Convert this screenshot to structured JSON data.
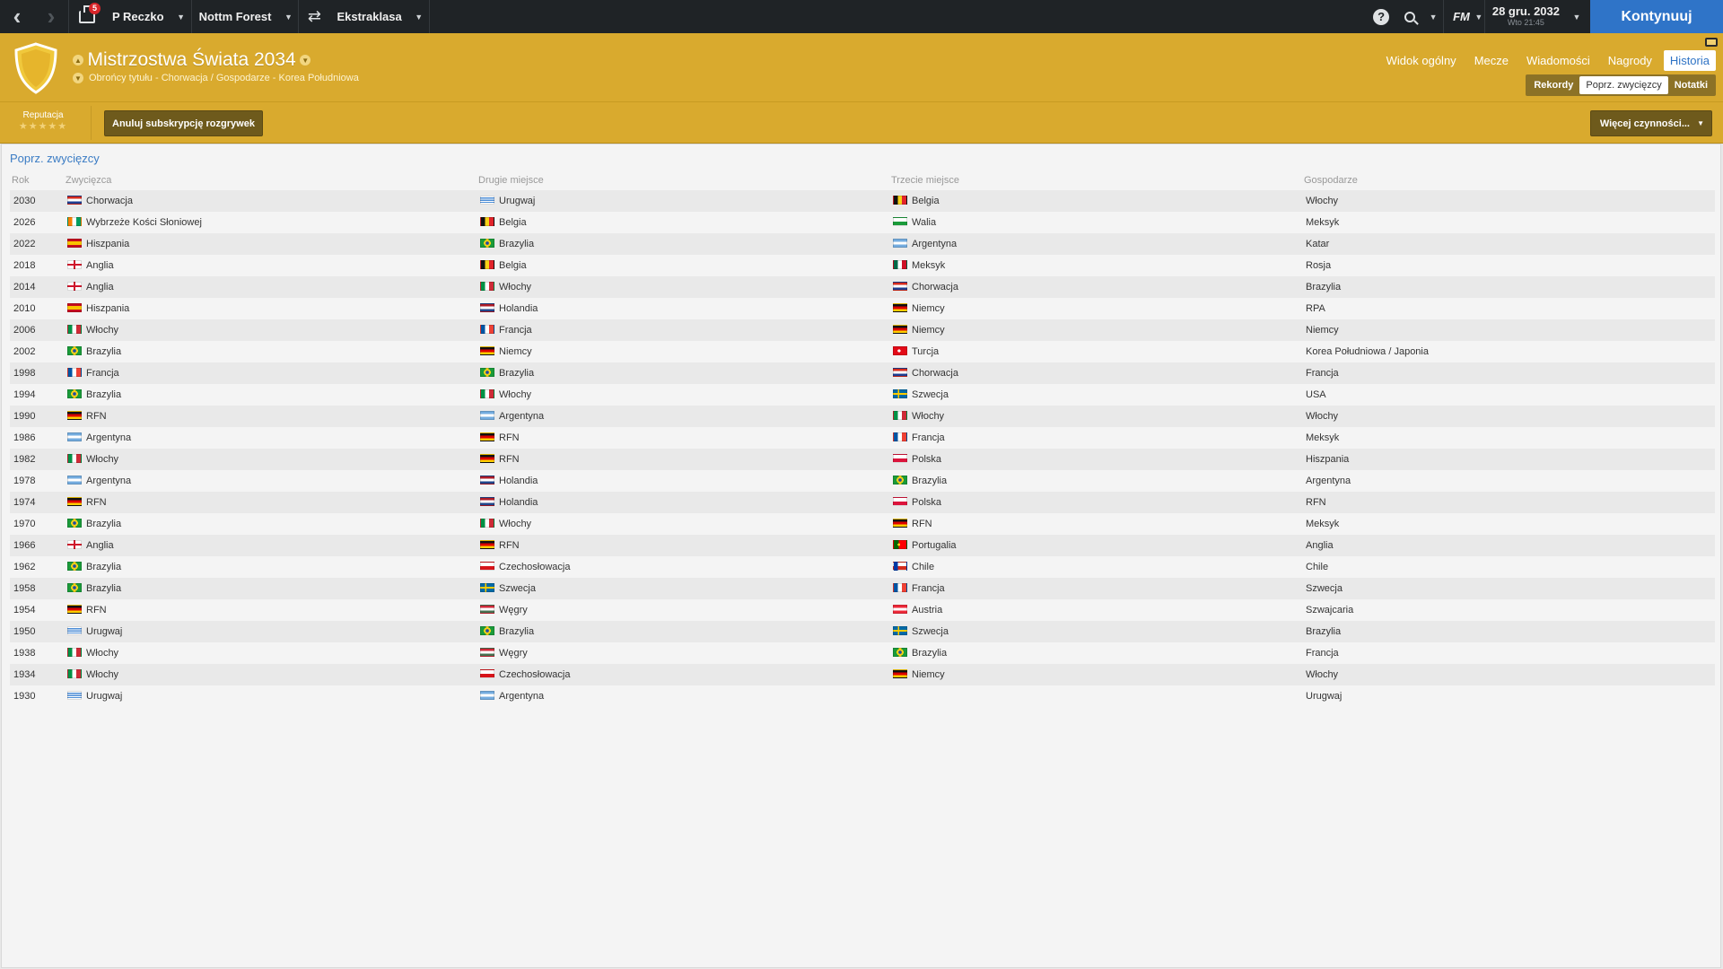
{
  "topbar": {
    "inbox_count": "5",
    "manager": "P Reczko",
    "club": "Nottm Forest",
    "league": "Ekstraklasa",
    "fm_logo": "FM",
    "date": "28 gru. 2032",
    "date_sub": "Wto 21:45",
    "continue_label": "Kontynuuj"
  },
  "header": {
    "title": "Mistrzostwa Świata 2034",
    "subtitle": "Obrońcy tytułu - Chorwacja / Gospodarze - Korea Południowa",
    "tabs": [
      "Widok ogólny",
      "Mecze",
      "Wiadomości",
      "Nagrody",
      "Historia"
    ],
    "active_tab": "Historia",
    "subtabs": [
      "Rekordy",
      "Poprz. zwycięzcy",
      "Notatki"
    ],
    "active_subtab": "Poprz. zwycięzcy",
    "accent_color": "#d9aa2e"
  },
  "actions": {
    "reputation_label": "Reputacja",
    "reputation_stars": "★★★★★",
    "unsubscribe_label": "Anuluj subskrypcję rozgrywek",
    "more_actions_label": "Więcej czynności..."
  },
  "content": {
    "section_title": "Poprz. zwycięzcy",
    "columns": {
      "year": "Rok",
      "winner": "Zwycięzca",
      "second": "Drugie miejsce",
      "third": "Trzecie miejsce",
      "host": "Gospodarze"
    },
    "rows": [
      {
        "year": "2030",
        "winner": "Chorwacja",
        "wf": "hr",
        "second": "Urugwaj",
        "sf": "uy",
        "third": "Belgia",
        "tf": "be",
        "host": "Włochy"
      },
      {
        "year": "2026",
        "winner": "Wybrzeże Kości Słoniowej",
        "wf": "ci",
        "second": "Belgia",
        "sf": "be",
        "third": "Walia",
        "tf": "wa",
        "host": "Meksyk"
      },
      {
        "year": "2022",
        "winner": "Hiszpania",
        "wf": "es",
        "second": "Brazylia",
        "sf": "br",
        "third": "Argentyna",
        "tf": "ar",
        "host": "Katar"
      },
      {
        "year": "2018",
        "winner": "Anglia",
        "wf": "en",
        "second": "Belgia",
        "sf": "be",
        "third": "Meksyk",
        "tf": "mx",
        "host": "Rosja"
      },
      {
        "year": "2014",
        "winner": "Anglia",
        "wf": "en",
        "second": "Włochy",
        "sf": "it",
        "third": "Chorwacja",
        "tf": "hr",
        "host": "Brazylia"
      },
      {
        "year": "2010",
        "winner": "Hiszpania",
        "wf": "es",
        "second": "Holandia",
        "sf": "nl",
        "third": "Niemcy",
        "tf": "de",
        "host": "RPA"
      },
      {
        "year": "2006",
        "winner": "Włochy",
        "wf": "it",
        "second": "Francja",
        "sf": "fr",
        "third": "Niemcy",
        "tf": "de",
        "host": "Niemcy"
      },
      {
        "year": "2002",
        "winner": "Brazylia",
        "wf": "br",
        "second": "Niemcy",
        "sf": "de",
        "third": "Turcja",
        "tf": "tr",
        "host": "Korea Południowa / Japonia"
      },
      {
        "year": "1998",
        "winner": "Francja",
        "wf": "fr",
        "second": "Brazylia",
        "sf": "br",
        "third": "Chorwacja",
        "tf": "hr",
        "host": "Francja"
      },
      {
        "year": "1994",
        "winner": "Brazylia",
        "wf": "br",
        "second": "Włochy",
        "sf": "it",
        "third": "Szwecja",
        "tf": "se",
        "host": "USA"
      },
      {
        "year": "1990",
        "winner": "RFN",
        "wf": "de",
        "second": "Argentyna",
        "sf": "ar",
        "third": "Włochy",
        "tf": "it",
        "host": "Włochy"
      },
      {
        "year": "1986",
        "winner": "Argentyna",
        "wf": "ar",
        "second": "RFN",
        "sf": "de",
        "third": "Francja",
        "tf": "fr",
        "host": "Meksyk"
      },
      {
        "year": "1982",
        "winner": "Włochy",
        "wf": "it",
        "second": "RFN",
        "sf": "de",
        "third": "Polska",
        "tf": "pl",
        "host": "Hiszpania"
      },
      {
        "year": "1978",
        "winner": "Argentyna",
        "wf": "ar",
        "second": "Holandia",
        "sf": "nl",
        "third": "Brazylia",
        "tf": "br",
        "host": "Argentyna"
      },
      {
        "year": "1974",
        "winner": "RFN",
        "wf": "de",
        "second": "Holandia",
        "sf": "nl",
        "third": "Polska",
        "tf": "pl",
        "host": "RFN"
      },
      {
        "year": "1970",
        "winner": "Brazylia",
        "wf": "br",
        "second": "Włochy",
        "sf": "it",
        "third": "RFN",
        "tf": "de",
        "host": "Meksyk"
      },
      {
        "year": "1966",
        "winner": "Anglia",
        "wf": "en",
        "second": "RFN",
        "sf": "de",
        "third": "Portugalia",
        "tf": "pt",
        "host": "Anglia"
      },
      {
        "year": "1962",
        "winner": "Brazylia",
        "wf": "br",
        "second": "Czechosłowacja",
        "sf": "cz",
        "third": "Chile",
        "tf": "cl",
        "host": "Chile"
      },
      {
        "year": "1958",
        "winner": "Brazylia",
        "wf": "br",
        "second": "Szwecja",
        "sf": "se",
        "third": "Francja",
        "tf": "fr",
        "host": "Szwecja"
      },
      {
        "year": "1954",
        "winner": "RFN",
        "wf": "de",
        "second": "Węgry",
        "sf": "hu",
        "third": "Austria",
        "tf": "at",
        "host": "Szwajcaria"
      },
      {
        "year": "1950",
        "winner": "Urugwaj",
        "wf": "uy",
        "second": "Brazylia",
        "sf": "br",
        "third": "Szwecja",
        "tf": "se",
        "host": "Brazylia"
      },
      {
        "year": "1938",
        "winner": "Włochy",
        "wf": "it",
        "second": "Węgry",
        "sf": "hu",
        "third": "Brazylia",
        "tf": "br",
        "host": "Francja"
      },
      {
        "year": "1934",
        "winner": "Włochy",
        "wf": "it",
        "second": "Czechosłowacja",
        "sf": "cz",
        "third": "Niemcy",
        "tf": "de",
        "host": "Włochy"
      },
      {
        "year": "1930",
        "winner": "Urugwaj",
        "wf": "uy",
        "second": "Argentyna",
        "sf": "ar",
        "third": "",
        "tf": "",
        "host": "Urugwaj"
      }
    ]
  }
}
